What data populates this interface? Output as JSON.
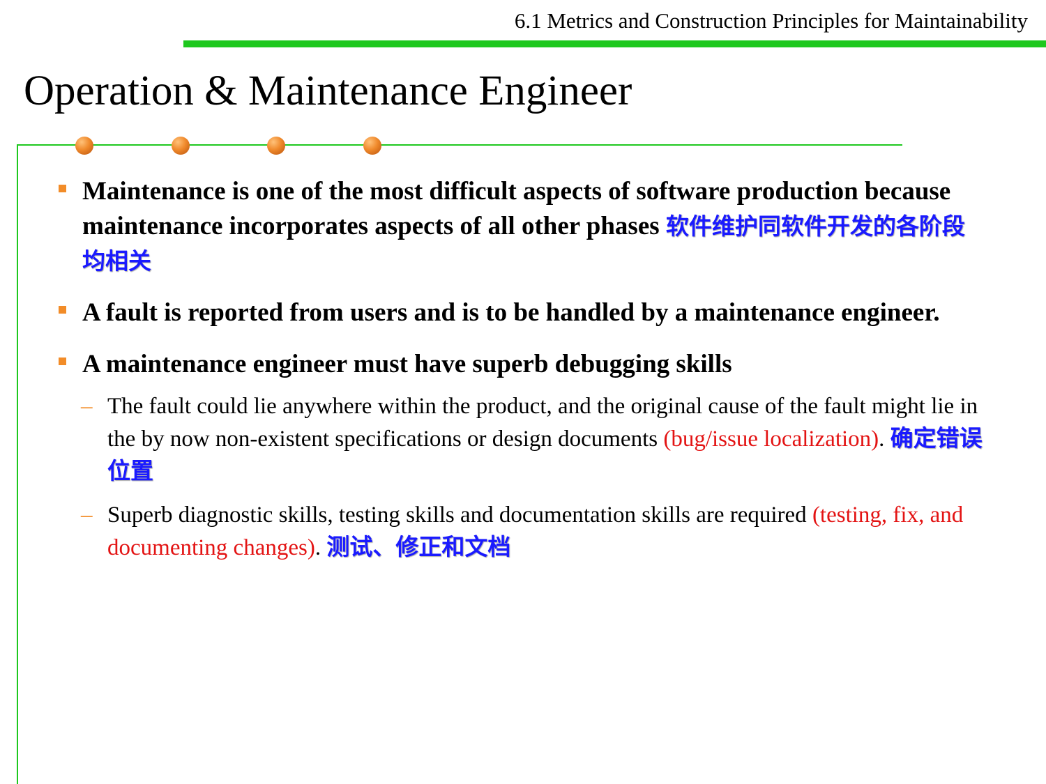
{
  "header": {
    "section": "6.1 Metrics and Construction Principles for Maintainability"
  },
  "slide": {
    "title": "Operation & Maintenance Engineer"
  },
  "bullets": [
    {
      "en": "Maintenance is one of the most difficult aspects of software production because maintenance incorporates aspects of all other phases",
      "cn": "软件维护同软件开发的各阶段均相关"
    },
    {
      "en": "A fault is reported from users and is to be handled by a maintenance engineer."
    },
    {
      "en": "A maintenance engineer must have superb debugging skills"
    }
  ],
  "subbullets": [
    {
      "text": "The fault could lie anywhere within the product, and the original cause of the fault might lie in the by now non-existent specifications or design documents",
      "red": "(bug/issue localization)",
      "period": ".",
      "cn": "确定错误位置"
    },
    {
      "text": "Superb diagnostic skills, testing skills and documentation skills are required",
      "red": "(testing, fix, and documenting changes)",
      "period": ".",
      "cn": "测试、修正和文档"
    }
  ],
  "colors": {
    "accent_green": "#1ec81e",
    "bullet_orange": "#f28c28",
    "chinese_blue": "#1a1aff",
    "highlight_red": "#e31313"
  }
}
